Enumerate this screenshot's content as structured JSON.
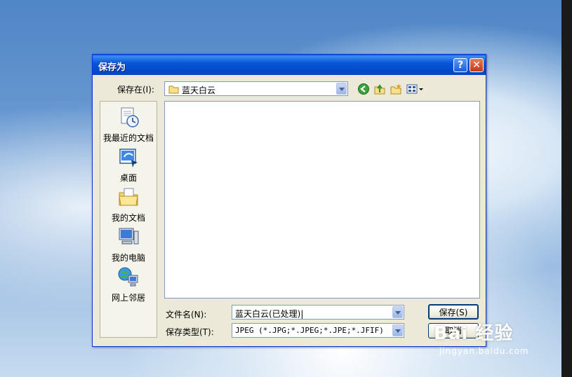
{
  "dialog": {
    "title": "保存为",
    "help_label": "?",
    "close_label": "✕",
    "save_in_label": "保存在(I):",
    "save_in_value": "蓝天白云",
    "places": [
      {
        "label": "我最近的文档",
        "icon": "recent-documents-icon"
      },
      {
        "label": "桌面",
        "icon": "desktop-icon"
      },
      {
        "label": "我的文档",
        "icon": "my-documents-icon"
      },
      {
        "label": "我的电脑",
        "icon": "my-computer-icon"
      },
      {
        "label": "网上邻居",
        "icon": "network-places-icon"
      }
    ],
    "filename_label": "文件名(N):",
    "filename_value": "蓝天白云(已处理)|",
    "filetype_label": "保存类型(T):",
    "filetype_value": "JPEG (*.JPG;*.JPEG;*.JPE;*.JFIF)",
    "save_button": "保存(S)",
    "cancel_button": "取消"
  },
  "watermark": {
    "main": "Bai 经验",
    "sub": "jingyan.baidu.com"
  },
  "colors": {
    "titlebar": "#0548c7",
    "dialog_bg": "#ece9d8",
    "close_red": "#c13a14"
  }
}
